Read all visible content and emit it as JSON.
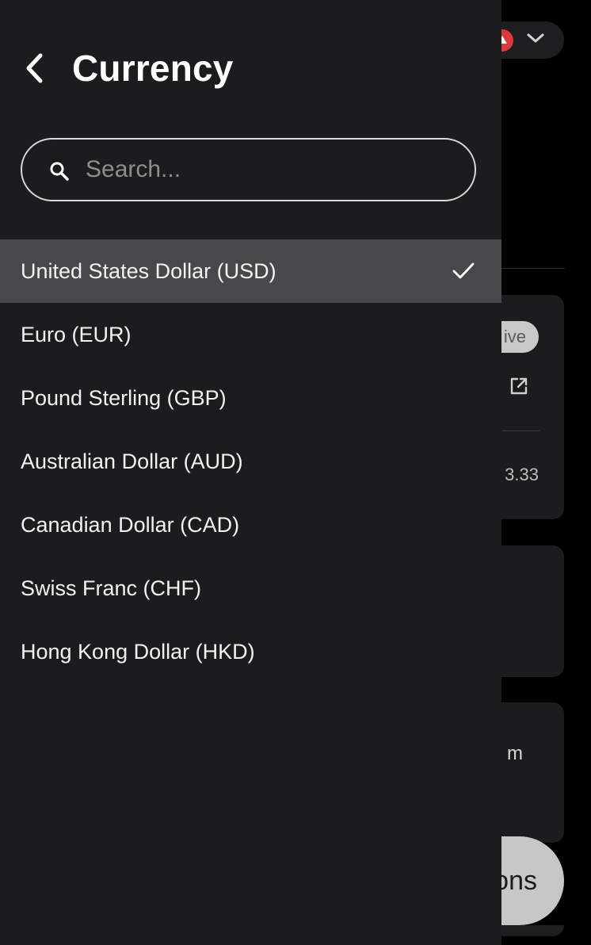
{
  "background": {
    "badge_text": "ive",
    "amount_text": "3.33",
    "card3_text": "m",
    "fab_label": "ons"
  },
  "panel": {
    "title": "Currency",
    "search": {
      "placeholder": "Search...",
      "value": ""
    },
    "currencies": [
      {
        "label": "United States Dollar (USD)",
        "selected": true
      },
      {
        "label": "Euro (EUR)",
        "selected": false
      },
      {
        "label": "Pound Sterling (GBP)",
        "selected": false
      },
      {
        "label": "Australian Dollar (AUD)",
        "selected": false
      },
      {
        "label": "Canadian Dollar (CAD)",
        "selected": false
      },
      {
        "label": "Swiss Franc (CHF)",
        "selected": false
      },
      {
        "label": "Hong Kong Dollar (HKD)",
        "selected": false
      }
    ]
  },
  "icons": {
    "back": "chevron-left-icon",
    "search": "search-icon",
    "check": "checkmark-icon",
    "external": "external-link-icon",
    "dropdown": "chevron-down-icon"
  },
  "colors": {
    "panel_bg": "#1c1c1e",
    "selected_row_bg": "#48484a",
    "page_bg": "#000000",
    "text_primary": "#ffffff",
    "placeholder": "#8e8e8e",
    "avatar_red": "#d93a3a"
  }
}
